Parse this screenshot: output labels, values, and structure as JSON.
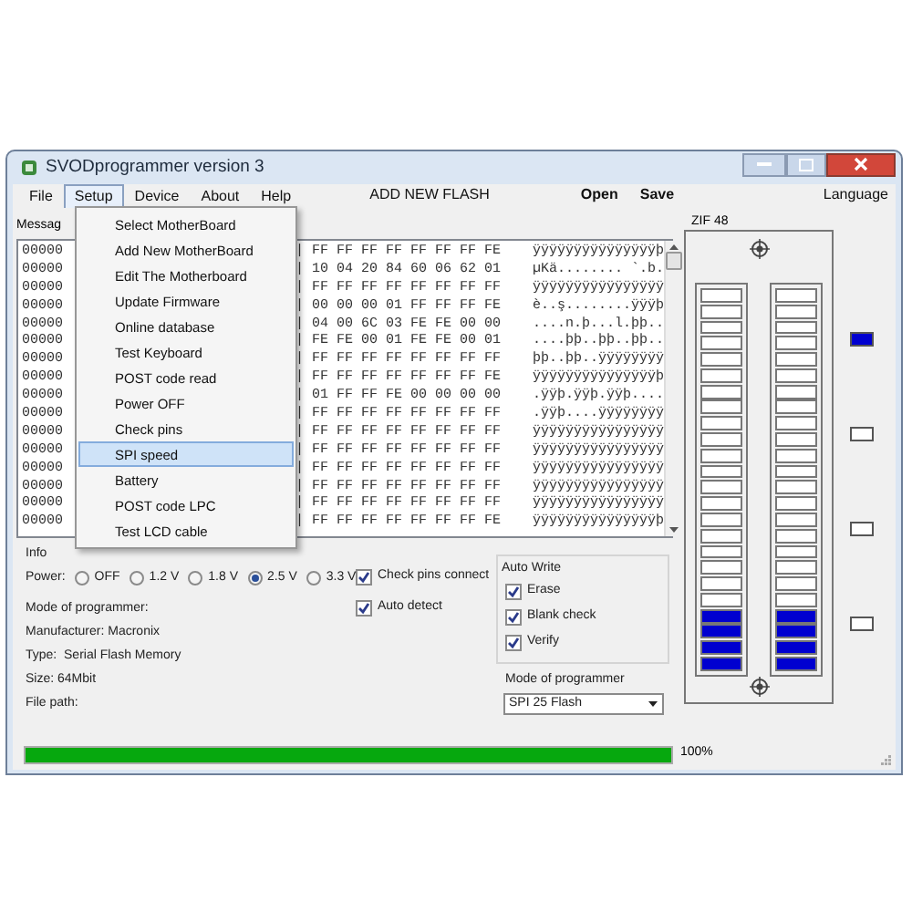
{
  "window": {
    "title": "SVODprogrammer version 3"
  },
  "menu": [
    {
      "label": "File",
      "selected": false
    },
    {
      "label": "Setup",
      "selected": true
    },
    {
      "label": "Device",
      "selected": false
    },
    {
      "label": "About",
      "selected": false
    },
    {
      "label": "Help",
      "selected": false
    }
  ],
  "toolbar": [
    {
      "label": "ADD NEW FLASH"
    },
    {
      "label": "Open"
    },
    {
      "label": "Save"
    }
  ],
  "language": "Language",
  "dropdown": [
    {
      "label": "Select MotherBoard",
      "selected": false
    },
    {
      "label": "Add New MotherBoard",
      "selected": false
    },
    {
      "label": "Edit The Motherboard",
      "selected": false
    },
    {
      "label": "Update Firmware",
      "selected": false
    },
    {
      "label": "Online database",
      "selected": false
    },
    {
      "label": "Test Keyboard",
      "selected": false
    },
    {
      "label": "POST code read",
      "selected": false
    },
    {
      "label": "Power OFF",
      "selected": false
    },
    {
      "label": "Check pins",
      "selected": false
    },
    {
      "label": "SPI speed",
      "selected": true
    },
    {
      "label": "Battery",
      "selected": false
    },
    {
      "label": "POST code LPC",
      "selected": false
    },
    {
      "label": "Test LCD cable",
      "selected": false
    }
  ],
  "message_label": "Messag",
  "hex_rows": [
    {
      "address": "00000",
      "hex": "| FF FF FF FF FF FF FF FE",
      "ascii": "ÿÿÿÿÿÿÿÿÿÿÿÿÿÿÿþ"
    },
    {
      "address": "00000",
      "hex": "| 10 04 20 84 60 06 62 01",
      "ascii": "µKä........ `.b."
    },
    {
      "address": "00000",
      "hex": "| FF FF FF FF FF FF FF FF",
      "ascii": "ÿÿÿÿÿÿÿÿÿÿÿÿÿÿÿÿ"
    },
    {
      "address": "00000",
      "hex": "| 00 00 00 01 FF FF FF FE",
      "ascii": "è..ş........ÿÿÿþ"
    },
    {
      "address": "00000",
      "hex": "| 04 00 6C 03 FE FE 00 00",
      "ascii": "....n.þ...l.þþ.."
    },
    {
      "address": "00000",
      "hex": "| FE FE 00 01 FE FE 00 01",
      "ascii": "....þþ..þþ..þþ.."
    },
    {
      "address": "00000",
      "hex": "| FF FF FF FF FF FF FF FF",
      "ascii": "þþ..þþ..ÿÿÿÿÿÿÿÿ"
    },
    {
      "address": "00000",
      "hex": "| FF FF FF FF FF FF FF FE",
      "ascii": "ÿÿÿÿÿÿÿÿÿÿÿÿÿÿÿþ"
    },
    {
      "address": "00000",
      "hex": "| 01 FF FF FE 00 00 00 00",
      "ascii": ".ÿÿþ.ÿÿþ.ÿÿþ...."
    },
    {
      "address": "00000",
      "hex": "| FF FF FF FF FF FF FF FF",
      "ascii": ".ÿÿþ....ÿÿÿÿÿÿÿÿ"
    },
    {
      "address": "00000",
      "hex": "| FF FF FF FF FF FF FF FF",
      "ascii": "ÿÿÿÿÿÿÿÿÿÿÿÿÿÿÿÿ"
    },
    {
      "address": "00000",
      "hex": "| FF FF FF FF FF FF FF FF",
      "ascii": "ÿÿÿÿÿÿÿÿÿÿÿÿÿÿÿÿ"
    },
    {
      "address": "00000",
      "hex": "| FF FF FF FF FF FF FF FF",
      "ascii": "ÿÿÿÿÿÿÿÿÿÿÿÿÿÿÿÿ"
    },
    {
      "address": "00000",
      "hex": "| FF FF FF FF FF FF FF FF",
      "ascii": "ÿÿÿÿÿÿÿÿÿÿÿÿÿÿÿÿ"
    },
    {
      "address": "00000",
      "hex": "| FF FF FF FF FF FF FF FF",
      "ascii": "ÿÿÿÿÿÿÿÿÿÿÿÿÿÿÿÿ"
    },
    {
      "address": "00000",
      "hex": "| FF FF FF FF FF FF FF FE",
      "ascii": "ÿÿÿÿÿÿÿÿÿÿÿÿÿÿÿþ"
    }
  ],
  "info": {
    "title": "Info",
    "power_label": "Power:",
    "power_options": [
      {
        "label": "OFF",
        "selected": false
      },
      {
        "label": "1.2 V",
        "selected": false
      },
      {
        "label": "1.8 V",
        "selected": false
      },
      {
        "label": "2.5 V",
        "selected": true
      },
      {
        "label": "3.3 V",
        "selected": false
      }
    ],
    "checkboxes": [
      {
        "label": "Check pins connect",
        "checked": true
      },
      {
        "label": "Auto detect",
        "checked": true
      }
    ],
    "details": [
      "Mode of programmer:",
      "Manufacturer: Macronix",
      "Type:  Serial Flash Memory",
      "Size: 64Mbit",
      "File path:"
    ],
    "auto_write": {
      "title": "Auto Write",
      "options": [
        {
          "label": "Erase",
          "checked": true
        },
        {
          "label": "Blank check",
          "checked": true
        },
        {
          "label": "Verify",
          "checked": true
        }
      ]
    },
    "mode_label": "Mode of programmer",
    "mode_value": "SPI 25 Flash"
  },
  "zif": {
    "title": "ZIF 48",
    "left_pins": [
      false,
      false,
      false,
      false,
      false,
      false,
      false,
      false,
      false,
      false,
      false,
      false,
      false,
      false,
      false,
      false,
      false,
      false,
      false,
      false,
      true,
      true,
      true,
      true
    ],
    "right_pins": [
      false,
      false,
      false,
      false,
      false,
      false,
      false,
      false,
      false,
      false,
      false,
      false,
      false,
      false,
      false,
      false,
      false,
      false,
      false,
      false,
      true,
      true,
      true,
      true
    ]
  },
  "indicators": [
    {
      "on": true
    },
    {
      "on": false
    },
    {
      "on": false
    },
    {
      "on": false
    }
  ],
  "progress": {
    "level": 1,
    "reading": "100%"
  }
}
